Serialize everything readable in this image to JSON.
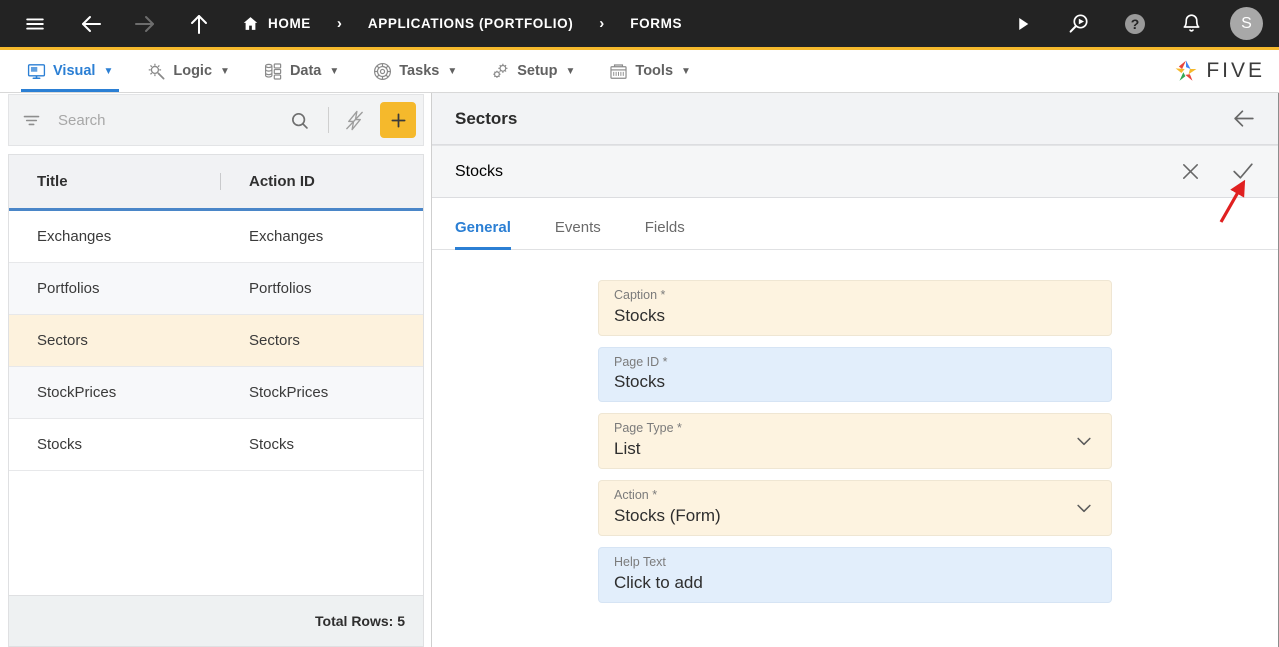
{
  "topbar": {
    "menu_icon": "hamburger-icon",
    "back_icon": "arrow-left-icon",
    "forward_icon": "arrow-right-icon",
    "up_icon": "arrow-up-icon",
    "breadcrumbs": [
      {
        "label": "HOME",
        "icon": "home-icon"
      },
      {
        "label": "APPLICATIONS (PORTFOLIO)",
        "icon": ""
      },
      {
        "label": "FORMS",
        "icon": ""
      }
    ],
    "separator": "›",
    "run_icon": "play-icon",
    "debug_icon": "search-play-icon",
    "help_icon": "question-circle-icon",
    "notifications_icon": "bell-icon",
    "avatar_initial": "S"
  },
  "menubar": {
    "items": [
      {
        "label": "Visual",
        "icon": "monitor-icon",
        "active": true
      },
      {
        "label": "Logic",
        "icon": "gear-wrench-icon",
        "active": false
      },
      {
        "label": "Data",
        "icon": "database-icon",
        "active": false
      },
      {
        "label": "Tasks",
        "icon": "target-icon",
        "active": false
      },
      {
        "label": "Setup",
        "icon": "gears-icon",
        "active": false
      },
      {
        "label": "Tools",
        "icon": "toolbox-icon",
        "active": false
      }
    ],
    "caret": "▼",
    "brand": "FIVE"
  },
  "left_panel": {
    "search": {
      "placeholder": "Search",
      "value": "",
      "filter_icon": "filter-icon",
      "search_icon": "search-icon",
      "bolt_icon": "lightning-disabled-icon",
      "add_label": "+"
    },
    "grid": {
      "columns": [
        "Title",
        "Action ID"
      ],
      "rows": [
        {
          "title": "Exchanges",
          "action_id": "Exchanges",
          "selected": false
        },
        {
          "title": "Portfolios",
          "action_id": "Portfolios",
          "selected": false
        },
        {
          "title": "Sectors",
          "action_id": "Sectors",
          "selected": true
        },
        {
          "title": "StockPrices",
          "action_id": "StockPrices",
          "selected": false
        },
        {
          "title": "Stocks",
          "action_id": "Stocks",
          "selected": false
        }
      ]
    },
    "footer": {
      "total_rows": "Total Rows: 5"
    }
  },
  "right_panel": {
    "header": {
      "title": "Sectors",
      "back_icon": "arrow-left-icon"
    },
    "subheader": {
      "title": "Stocks",
      "cancel_icon": "close-icon",
      "confirm_icon": "check-icon"
    },
    "tabs": [
      {
        "label": "General",
        "active": true
      },
      {
        "label": "Events",
        "active": false
      },
      {
        "label": "Fields",
        "active": false
      }
    ],
    "fields": [
      {
        "label": "Caption *",
        "value": "Stocks",
        "style": "cream",
        "dropdown": false
      },
      {
        "label": "Page ID *",
        "value": "Stocks",
        "style": "blue",
        "dropdown": false
      },
      {
        "label": "Page Type *",
        "value": "List",
        "style": "cream",
        "dropdown": true
      },
      {
        "label": "Action *",
        "value": "Stocks (Form)",
        "style": "cream",
        "dropdown": true
      },
      {
        "label": "Help Text",
        "value": "Click to add",
        "style": "blue",
        "dropdown": false
      }
    ]
  },
  "annotation": {
    "arrow_color": "#e02020",
    "points_to": "confirm-check-icon"
  },
  "colors": {
    "accent_yellow": "#f5b92c",
    "accent_blue": "#2b7fd4",
    "topbar_bg": "#232323",
    "field_cream": "#fdf3e0",
    "field_blue": "#e2eefb",
    "row_selected": "#fdf2dd"
  }
}
